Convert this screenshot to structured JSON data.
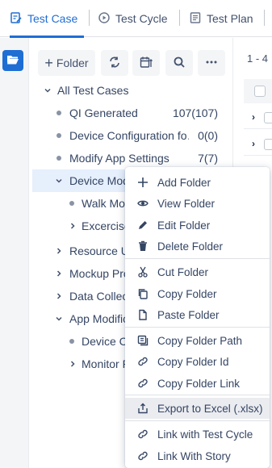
{
  "tabs": [
    {
      "label": "Test Case",
      "icon": "test-case-icon",
      "active": true
    },
    {
      "label": "Test Cycle",
      "icon": "test-cycle-icon",
      "active": false
    },
    {
      "label": "Test Plan",
      "icon": "test-plan-icon",
      "active": false
    }
  ],
  "toolbar": {
    "folder_button": "Folder"
  },
  "pagination": {
    "range": "1 - 4"
  },
  "tree": {
    "root": "All Test Cases",
    "items": [
      {
        "label": "QI Generated",
        "count": "107(107)"
      },
      {
        "label": "Device Configuration fo…",
        "count": "0(0)"
      },
      {
        "label": "Modify App Settings",
        "count": "7(7)"
      },
      {
        "label": "Device Mod"
      },
      {
        "label": "Walk Moc"
      },
      {
        "label": "Excercise"
      },
      {
        "label": "Resource Ut"
      },
      {
        "label": "Mockup Pro"
      },
      {
        "label": "Data Collect"
      },
      {
        "label": "App Modific"
      },
      {
        "label": "Device Co"
      },
      {
        "label": "Monitor P"
      }
    ]
  },
  "context_menu": {
    "items": [
      {
        "label": "Add Folder",
        "icon": "plus-icon"
      },
      {
        "label": "View Folder",
        "icon": "eye-icon"
      },
      {
        "label": "Edit Folder",
        "icon": "pencil-icon"
      },
      {
        "label": "Delete Folder",
        "icon": "trash-icon"
      },
      {
        "label": "Cut Folder",
        "icon": "scissors-icon"
      },
      {
        "label": "Copy Folder",
        "icon": "copy-icon"
      },
      {
        "label": "Paste Folder",
        "icon": "paste-icon"
      },
      {
        "label": "Copy Folder Path",
        "icon": "copy-path-icon"
      },
      {
        "label": "Copy Folder Id",
        "icon": "link-icon"
      },
      {
        "label": "Copy Folder Link",
        "icon": "link-icon"
      },
      {
        "label": "Export to Excel (.xlsx)",
        "icon": "export-icon"
      },
      {
        "label": "Link with Test Cycle",
        "icon": "link-icon"
      },
      {
        "label": "Link With Story",
        "icon": "link-icon"
      }
    ]
  },
  "colors": {
    "accent": "#1f6ed4",
    "selected_row": "#e6effc",
    "hover_row": "#ebecf0"
  }
}
